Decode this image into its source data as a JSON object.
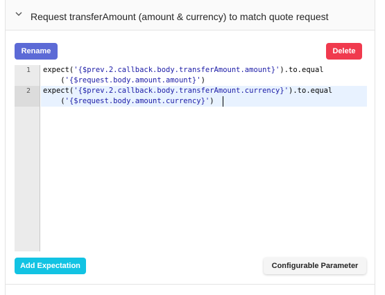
{
  "header": {
    "title": "Request transferAmount (amount & currency) to match quote request"
  },
  "actions": {
    "rename_label": "Rename",
    "delete_label": "Delete",
    "add_expectation_label": "Add Expectation",
    "configurable_parameter_label": "Configurable Parameter"
  },
  "editor": {
    "lines": [
      {
        "number": "1",
        "pre": "expect(",
        "str": "'{$prev.2.callback.body.transferAmount.amount}'",
        "post": ").to.equal",
        "wrap_pre": "    (",
        "wrap_str": "'{$request.body.amount.amount}'",
        "wrap_post": ")"
      },
      {
        "number": "2",
        "pre": "expect(",
        "str": "'{$prev.2.callback.body.transferAmount.currency}'",
        "post": ").to.equal",
        "wrap_pre": "    (",
        "wrap_str": "'{$request.body.amount.currency}'",
        "wrap_post": ")"
      }
    ]
  },
  "colors": {
    "rename": "#5c6ad6",
    "delete": "#f03a4e",
    "add_expectation": "#12c3e3",
    "string": "#1a1aa6"
  }
}
